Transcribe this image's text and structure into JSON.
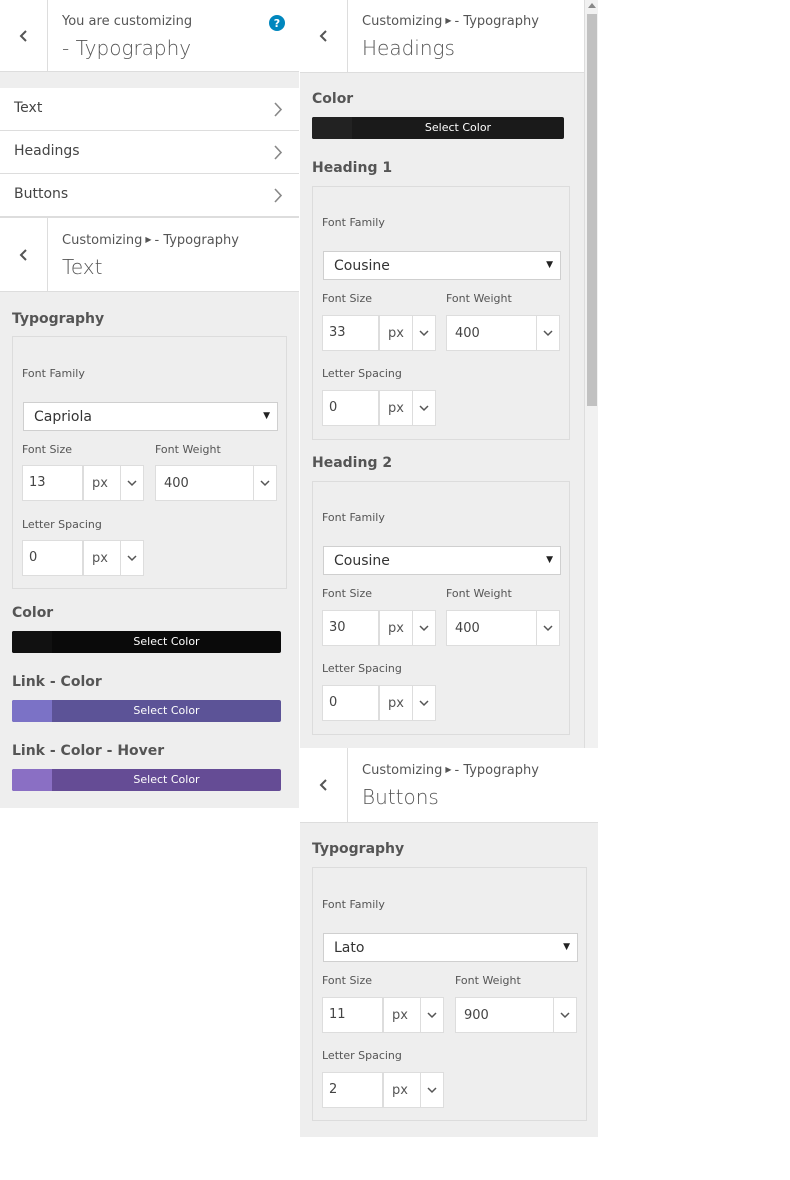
{
  "main_panel": {
    "crumb": "You are customizing",
    "title": "- Typography",
    "help_icon": "?",
    "nav_items": [
      {
        "label": "Text",
        "icon": "chevron-right-icon"
      },
      {
        "label": "Headings",
        "icon": "chevron-right-icon"
      },
      {
        "label": "Buttons",
        "icon": "chevron-right-icon"
      }
    ]
  },
  "text_panel": {
    "crumb_prefix": "Customizing",
    "crumb_suffix": "- Typography",
    "title": "Text",
    "section_title": "Typography",
    "font_family_label": "Font Family",
    "font_family": "Capriola",
    "font_size_label": "Font Size",
    "font_size": "13",
    "font_size_unit": "px",
    "font_weight_label": "Font Weight",
    "font_weight": "400",
    "letter_spacing_label": "Letter Spacing",
    "letter_spacing": "0",
    "letter_spacing_unit": "px",
    "colors": [
      {
        "label": "Color",
        "button": "Select Color",
        "swatch": "#111111",
        "bar": "#0a0a0a"
      },
      {
        "label": "Link - Color",
        "button": "Select Color",
        "swatch": "#7b72c6",
        "bar": "#5c5397"
      },
      {
        "label": "Link - Color - Hover",
        "button": "Select Color",
        "swatch": "#8a6fc4",
        "bar": "#654c95"
      }
    ]
  },
  "headings_panel": {
    "crumb_prefix": "Customizing",
    "crumb_suffix": "- Typography",
    "title": "Headings",
    "color_label": "Color",
    "color_button": "Select Color",
    "color_swatch": "#222222",
    "color_bar": "#1a1a1a",
    "headings": [
      {
        "title": "Heading 1",
        "font_family_label": "Font Family",
        "font_family": "Cousine",
        "font_size_label": "Font Size",
        "font_size": "33",
        "font_size_unit": "px",
        "font_weight_label": "Font Weight",
        "font_weight": "400",
        "letter_spacing_label": "Letter Spacing",
        "letter_spacing": "0",
        "letter_spacing_unit": "px"
      },
      {
        "title": "Heading 2",
        "font_family_label": "Font Family",
        "font_family": "Cousine",
        "font_size_label": "Font Size",
        "font_size": "30",
        "font_size_unit": "px",
        "font_weight_label": "Font Weight",
        "font_weight": "400",
        "letter_spacing_label": "Letter Spacing",
        "letter_spacing": "0",
        "letter_spacing_unit": "px"
      }
    ]
  },
  "buttons_panel": {
    "crumb_prefix": "Customizing",
    "crumb_suffix": "- Typography",
    "title": "Buttons",
    "section_title": "Typography",
    "font_family_label": "Font Family",
    "font_family": "Lato",
    "font_size_label": "Font Size",
    "font_size": "11",
    "font_size_unit": "px",
    "font_weight_label": "Font Weight",
    "font_weight": "900",
    "letter_spacing_label": "Letter Spacing",
    "letter_spacing": "2",
    "letter_spacing_unit": "px"
  }
}
